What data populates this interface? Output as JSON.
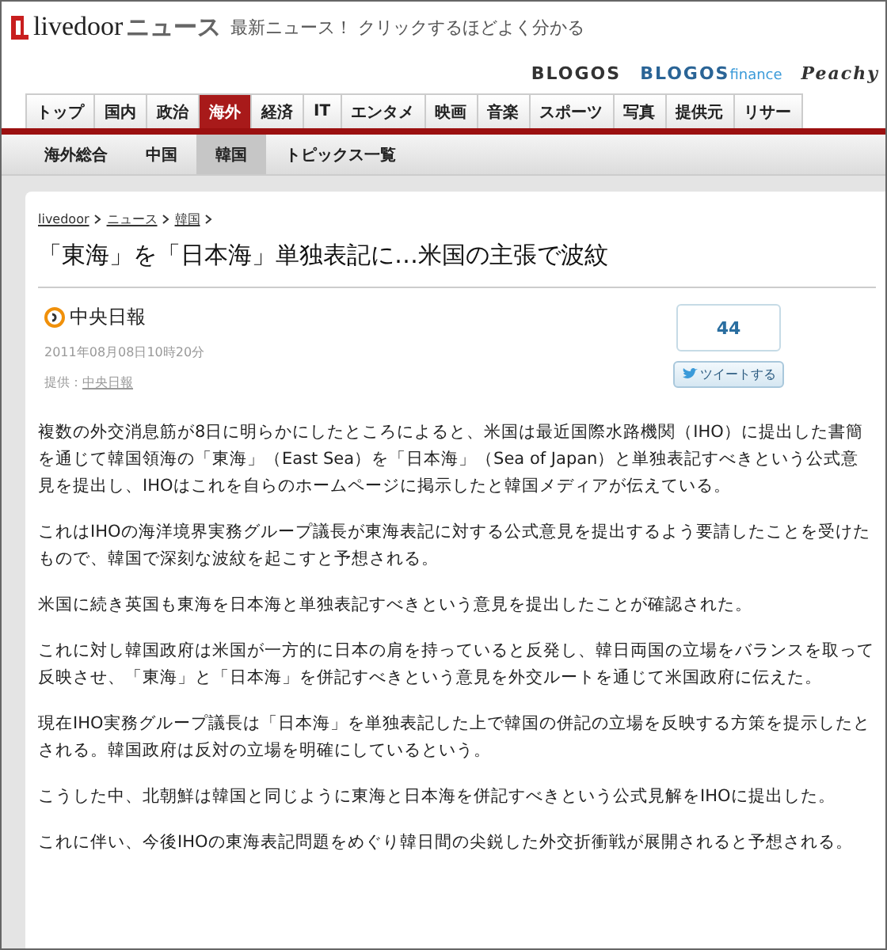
{
  "header": {
    "logo": {
      "brand": "livedoor",
      "section": "ニュース"
    },
    "tagline": "最新ニュース！ クリックするほどよく分かる"
  },
  "partner_links": [
    {
      "label": "BLOGOS",
      "kind": "plain"
    },
    {
      "label": "BLOGOS",
      "suffix": "finance",
      "kind": "finance"
    },
    {
      "label": "Peachy",
      "kind": "script"
    }
  ],
  "nav_tabs": [
    {
      "label": "トップ",
      "selected": false
    },
    {
      "label": "国内",
      "selected": false
    },
    {
      "label": "政治",
      "selected": false
    },
    {
      "label": "海外",
      "selected": true
    },
    {
      "label": "経済",
      "selected": false
    },
    {
      "label": "IT",
      "selected": false
    },
    {
      "label": "エンタメ",
      "selected": false
    },
    {
      "label": "映画",
      "selected": false
    },
    {
      "label": "音楽",
      "selected": false
    },
    {
      "label": "スポーツ",
      "selected": false
    },
    {
      "label": "写真",
      "selected": false
    },
    {
      "label": "提供元",
      "selected": false
    },
    {
      "label": "リサー",
      "selected": false
    }
  ],
  "sub_tabs": [
    {
      "label": "海外総合",
      "selected": false
    },
    {
      "label": "中国",
      "selected": false
    },
    {
      "label": "韓国",
      "selected": true
    },
    {
      "label": "トピックス一覧",
      "selected": false
    }
  ],
  "article": {
    "breadcrumb": [
      "livedoor",
      "ニュース",
      "韓国"
    ],
    "title": "「東海」を「日本海」単独表記に…米国の主張で波紋",
    "source": "中央日報",
    "date": "2011年08月08日10時20分",
    "provider_label": "提供：",
    "provider": "中央日報",
    "tweet_count": "44",
    "tweet_button": "ツイートする",
    "paragraphs": [
      "複数の外交消息筋が8日に明らかにしたところによると、米国は最近国際水路機関（IHO）に提出した書簡を通じて韓国領海の「東海」（East Sea）を「日本海」（Sea of Japan）と単独表記すべきという公式意見を提出し、IHOはこれを自らのホームページに掲示したと韓国メディアが伝えている。",
      "これはIHOの海洋境界実務グループ議長が東海表記に対する公式意見を提出するよう要請したことを受けたもので、韓国で深刻な波紋を起こすと予想される。",
      "米国に続き英国も東海を日本海と単独表記すべきという意見を提出したことが確認された。",
      "これに対し韓国政府は米国が一方的に日本の肩を持っていると反発し、韓日両国の立場をバランスを取って反映させ、「東海」と「日本海」を併記すべきという意見を外交ルートを通じて米国政府に伝えた。",
      "現在IHO実務グループ議長は「日本海」を単独表記した上で韓国の併記の立場を反映する方策を提示したとされる。韓国政府は反対の立場を明確にしているという。",
      "こうした中、北朝鮮は韓国と同じように東海と日本海を併記すべきという公式見解をIHOに提出した。",
      "これに伴い、今後IHOの東海表記問題をめぐり韓日間の尖鋭した外交折衝戦が展開されると予想される。"
    ]
  }
}
